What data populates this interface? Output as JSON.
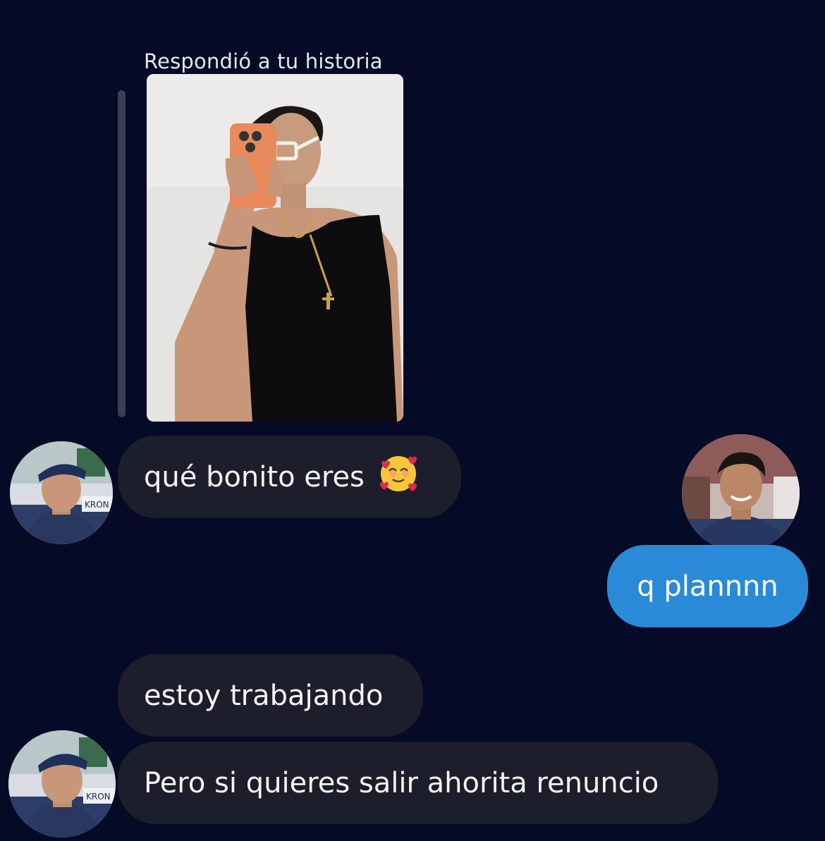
{
  "thread": {
    "reply_label": "Respondió a tu historia",
    "messages": [
      {
        "from": "them",
        "text": "qué bonito eres",
        "emoji": "smiling-face-with-hearts"
      },
      {
        "from": "me",
        "text": "q plannnn"
      },
      {
        "from": "them",
        "text": "estoy trabajando"
      },
      {
        "from": "them",
        "text": "Pero si quieres salir ahorita renuncio"
      }
    ]
  },
  "avatars": {
    "them_jersey_text": "ΚRON"
  },
  "colors": {
    "background": "#050a26",
    "received_bubble": "#1c1e2b",
    "sent_bubble": "#2a8ad8",
    "reply_bar": "#3a3e52"
  }
}
